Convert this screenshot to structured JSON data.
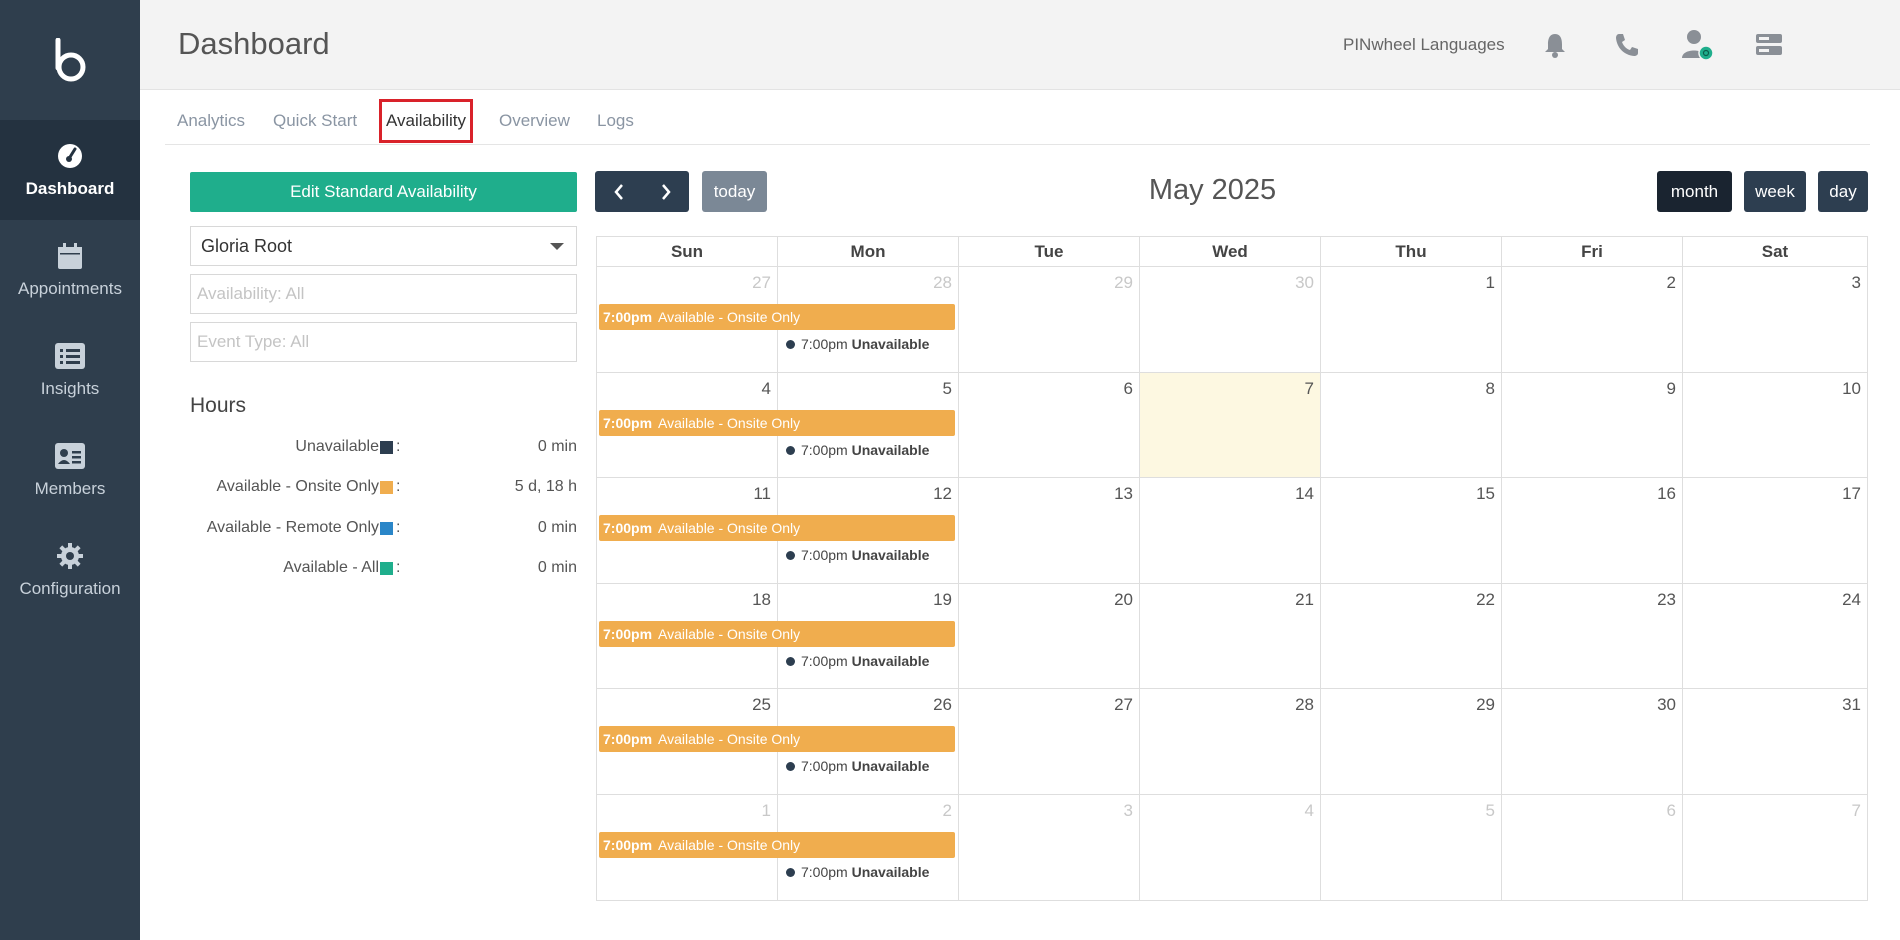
{
  "header": {
    "title": "Dashboard",
    "company": "PINwheel Languages"
  },
  "sidebar": {
    "items": [
      {
        "label": "Dashboard",
        "icon": "gauge-icon",
        "active": true
      },
      {
        "label": "Appointments",
        "icon": "calendar-icon",
        "active": false
      },
      {
        "label": "Insights",
        "icon": "list-icon",
        "active": false
      },
      {
        "label": "Members",
        "icon": "id-card-icon",
        "active": false
      },
      {
        "label": "Configuration",
        "icon": "gear-icon",
        "active": false
      }
    ]
  },
  "tabs": [
    {
      "label": "Analytics",
      "active": false
    },
    {
      "label": "Quick Start",
      "active": false
    },
    {
      "label": "Availability",
      "active": true
    },
    {
      "label": "Overview",
      "active": false
    },
    {
      "label": "Logs",
      "active": false
    }
  ],
  "left_panel": {
    "edit_button": "Edit Standard Availability",
    "member_select": "Gloria Root",
    "availability_placeholder": "Availability: All",
    "event_type_placeholder": "Event Type: All",
    "hours_title": "Hours",
    "legend": [
      {
        "name": "Unavailable",
        "color": "#2d3e50",
        "colon": ":",
        "value": "0 min"
      },
      {
        "name": "Available - Onsite Only",
        "color": "#f0ad4e",
        "colon": ":",
        "value": "5 d, 18 h"
      },
      {
        "name": "Available - Remote Only",
        "color": "#2a86c8",
        "colon": ":",
        "value": "0 min"
      },
      {
        "name": "Available - All",
        "color": "#1fae8c",
        "colon": ":",
        "value": "0 min"
      }
    ]
  },
  "calendar": {
    "title": "May 2025",
    "today_label": "today",
    "prev_icon": "chevron-left-icon",
    "next_icon": "chevron-right-icon",
    "views": [
      {
        "label": "month",
        "active": true
      },
      {
        "label": "week",
        "active": false
      },
      {
        "label": "day",
        "active": false
      }
    ],
    "days_of_week": [
      "Sun",
      "Mon",
      "Tue",
      "Wed",
      "Thu",
      "Fri",
      "Sat"
    ],
    "weeks": [
      [
        "27",
        "28",
        "29",
        "30",
        "1",
        "2",
        "3"
      ],
      [
        "4",
        "5",
        "6",
        "7",
        "8",
        "9",
        "10"
      ],
      [
        "11",
        "12",
        "13",
        "14",
        "15",
        "16",
        "17"
      ],
      [
        "18",
        "19",
        "20",
        "21",
        "22",
        "23",
        "24"
      ],
      [
        "25",
        "26",
        "27",
        "28",
        "29",
        "30",
        "31"
      ],
      [
        "1",
        "2",
        "3",
        "4",
        "5",
        "6",
        "7"
      ]
    ],
    "highlighted_date": "7",
    "event_bar": {
      "time": "7:00pm",
      "title": "Available - Onsite Only"
    },
    "event_dot": {
      "time": "7:00pm",
      "title": "Unavailable"
    }
  }
}
